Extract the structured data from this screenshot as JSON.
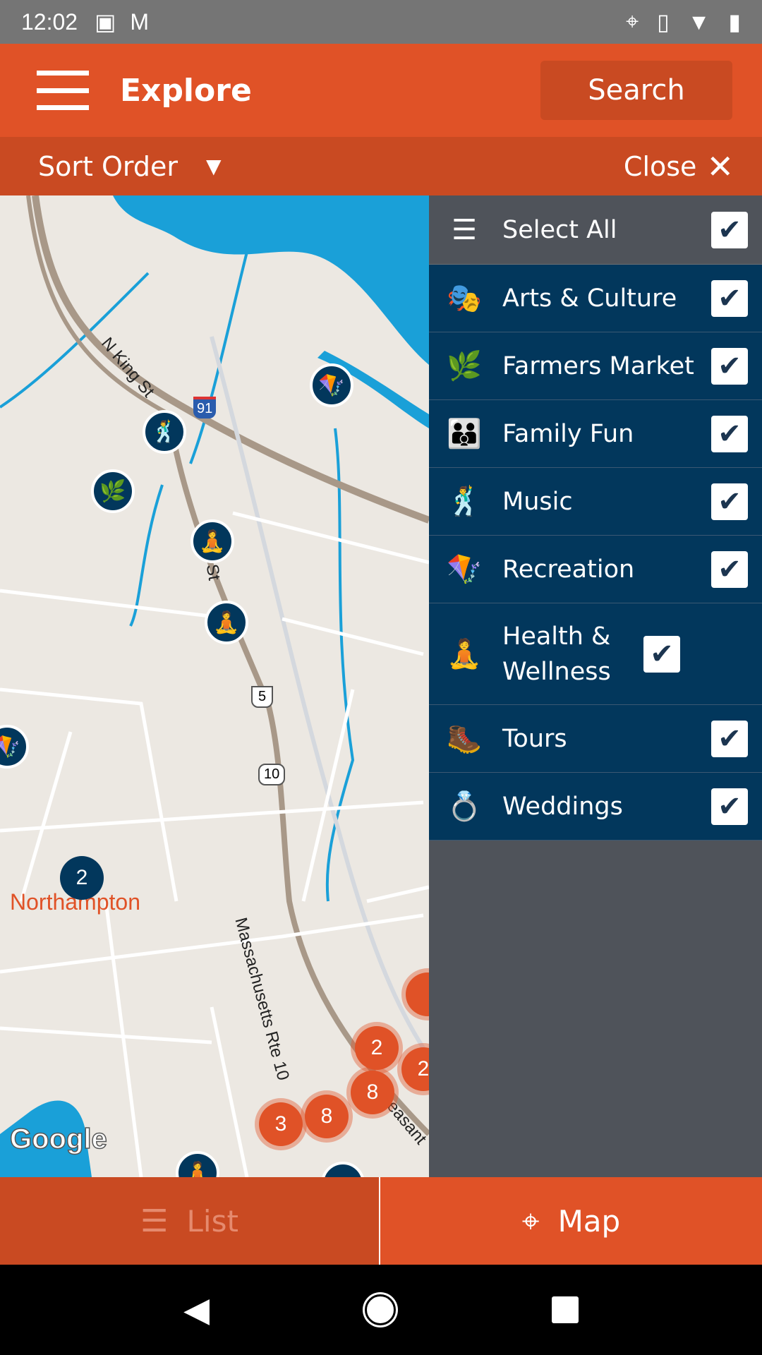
{
  "status": {
    "time": "12:02"
  },
  "header": {
    "title": "Explore",
    "search_label": "Search"
  },
  "sortbar": {
    "sort_label": "Sort Order",
    "close_label": "Close"
  },
  "filters": [
    {
      "label": "Select All",
      "icon": "select-all-icon",
      "glyph": "☰",
      "checked": true
    },
    {
      "label": "Arts & Culture",
      "icon": "theater-masks-icon",
      "glyph": "🎭",
      "checked": true
    },
    {
      "label": "Farmers Market",
      "icon": "farmers-market-icon",
      "glyph": "🌿",
      "checked": true
    },
    {
      "label": "Family Fun",
      "icon": "family-icon",
      "glyph": "👪",
      "checked": true
    },
    {
      "label": "Music",
      "icon": "music-dancer-icon",
      "glyph": "🕺",
      "checked": true
    },
    {
      "label": "Recreation",
      "icon": "kite-icon",
      "glyph": "🪁",
      "checked": true
    },
    {
      "label": "Health & Wellness",
      "icon": "wellness-icon",
      "glyph": "🧘",
      "checked": true
    },
    {
      "label": "Tours",
      "icon": "hiker-icon",
      "glyph": "🥾",
      "checked": true
    },
    {
      "label": "Weddings",
      "icon": "rings-icon",
      "glyph": "💍",
      "checked": true
    }
  ],
  "map": {
    "place_label": "Northampton",
    "road_labels": [
      "N King St",
      "St",
      "Massachusetts Rte 10",
      "easant"
    ],
    "shields": [
      "91",
      "5",
      "10"
    ],
    "attribution": "Google",
    "clusters": [
      "2",
      "2",
      "8",
      "8",
      "3"
    ],
    "dark_cluster": "2"
  },
  "bottom": {
    "list_label": "List",
    "map_label": "Map"
  },
  "colors": {
    "primary": "#e05227",
    "primary_dark": "#c94a22",
    "navy": "#02375c",
    "panel_gray": "#4f535a"
  }
}
